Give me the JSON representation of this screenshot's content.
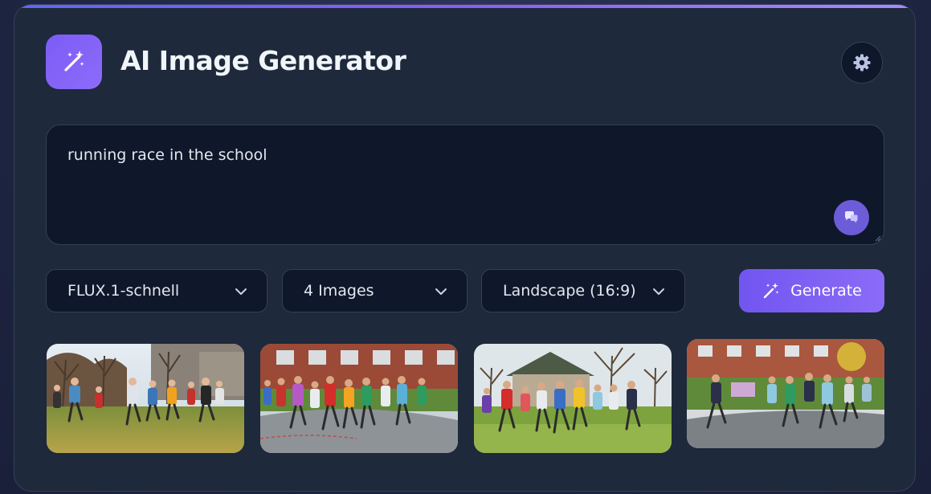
{
  "header": {
    "title": "AI Image Generator",
    "logo_icon": "magic-wand-icon",
    "settings_icon": "gear-icon"
  },
  "prompt": {
    "value": "running race in the school",
    "enhance_icon": "chat-bubbles-icon"
  },
  "controls": {
    "model": {
      "selected": "FLUX.1-schnell"
    },
    "count": {
      "selected": "4 Images"
    },
    "aspect": {
      "selected": "Landscape (16:9)"
    },
    "generate_label": "Generate",
    "generate_icon": "magic-wand-icon"
  },
  "results": {
    "images": [
      {
        "name": "result-image-1"
      },
      {
        "name": "result-image-2"
      },
      {
        "name": "result-image-3"
      },
      {
        "name": "result-image-4"
      }
    ]
  },
  "colors": {
    "accent": "#7c5cf6",
    "card_bg": "#1e293b",
    "field_bg": "#0f172a",
    "border": "#334155",
    "text": "#e2e8f0"
  }
}
